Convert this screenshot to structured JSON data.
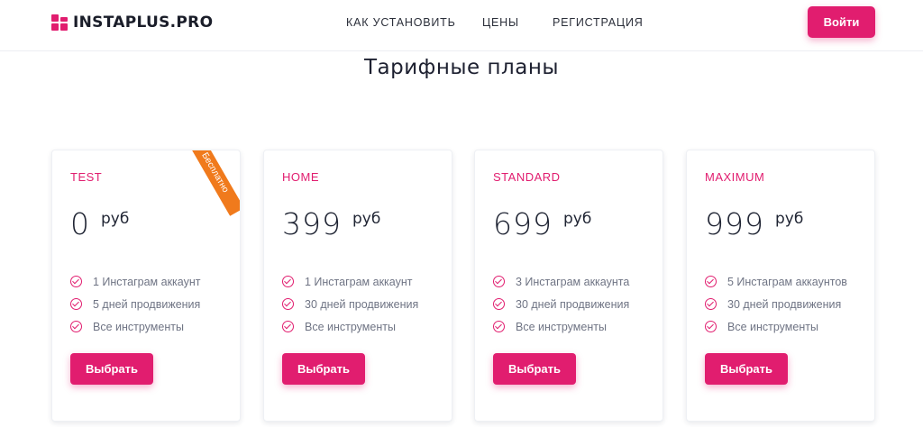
{
  "brand": {
    "name": "INSTAPLUS.PRO",
    "accent": "#e11d6f",
    "ribbon_color": "#f07a1c"
  },
  "nav": {
    "items": [
      "КАК УСТАНОВИТЬ",
      "ЦЕНЫ",
      "РЕГИСТРАЦИЯ"
    ]
  },
  "header": {
    "login_label": "Войти"
  },
  "page": {
    "title": "Тарифные планы"
  },
  "plans": [
    {
      "name": "TEST",
      "price": "0",
      "unit": "руб",
      "ribbon": "Бесплатно",
      "features": [
        "1 Инстаграм аккаунт",
        "5 дней продвижения",
        "Все инструменты"
      ],
      "button": "Выбрать"
    },
    {
      "name": "HOME",
      "price": "399",
      "unit": "руб",
      "features": [
        "1 Инстаграм аккаунт",
        "30 дней продвижения",
        "Все инструменты"
      ],
      "button": "Выбрать"
    },
    {
      "name": "STANDARD",
      "price": "699",
      "unit": "руб",
      "features": [
        "3 Инстаграм аккаунта",
        "30 дней продвижения",
        "Все инструменты"
      ],
      "button": "Выбрать"
    },
    {
      "name": "MAXIMUM",
      "price": "999",
      "unit": "руб",
      "features": [
        "5 Инстаграм аккаунтов",
        "30 дней продвижения",
        "Все инструменты"
      ],
      "button": "Выбрать"
    }
  ]
}
